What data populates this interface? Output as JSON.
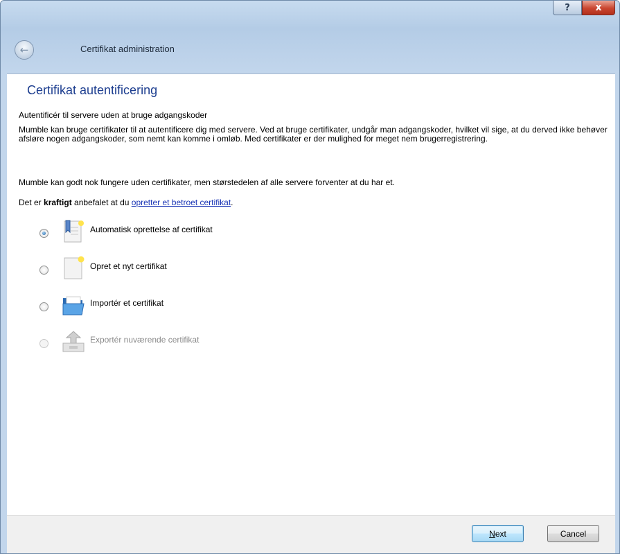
{
  "window": {
    "help_label": "?",
    "close_label": "x",
    "back_label": "←",
    "title": "Certifikat administration"
  },
  "page": {
    "heading": "Certifikat autentificering",
    "subtitle": "Autentificér til servere uden at bruge adgangskoder",
    "paragraph1": "Mumble kan bruge certifikater til at autentificere dig med servere. Ved at bruge certifikater, undgår man adgangskoder, hvilket vil sige, at du derved ikke behøver afsløre nogen adgangskoder, som nemt kan komme i omløb. Med certifikater er der mulighed for meget nem brugerregistrering.",
    "paragraph2": "Mumble kan godt nok fungere uden certifikater, men størstedelen af alle servere forventer at du har et.",
    "paragraph3_prefix": "Det er ",
    "paragraph3_bold": "kraftigt",
    "paragraph3_middle": " anbefalet at du ",
    "paragraph3_link": "opretter et betroet certifikat",
    "paragraph3_suffix": "."
  },
  "options": [
    {
      "label": "Automatisk oprettelse af certifikat",
      "icon": "bookmark-certificate-icon",
      "selected": true,
      "enabled": true
    },
    {
      "label": "Opret et nyt certifikat",
      "icon": "new-document-icon",
      "selected": false,
      "enabled": true
    },
    {
      "label": "Importér et certifikat",
      "icon": "folder-icon",
      "selected": false,
      "enabled": true
    },
    {
      "label": "Exportér nuværende certifikat",
      "icon": "export-tray-icon",
      "selected": false,
      "enabled": false
    }
  ],
  "footer": {
    "next_mnemonic": "N",
    "next_rest": "ext",
    "cancel_label": "Cancel"
  }
}
